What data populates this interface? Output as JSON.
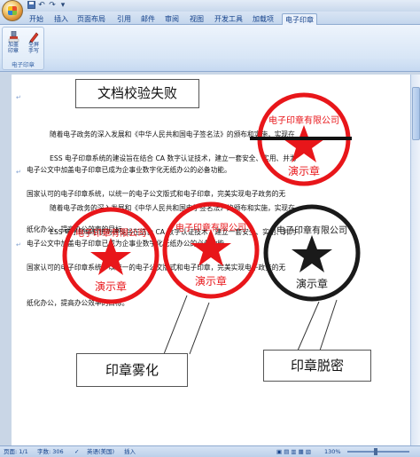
{
  "quick_access": {
    "save_icon": "save-icon",
    "undo_icon": "undo-icon",
    "redo_icon": "redo-icon"
  },
  "tabs": [
    {
      "label": "开始",
      "active": false
    },
    {
      "label": "插入",
      "active": false
    },
    {
      "label": "页面布局",
      "active": false
    },
    {
      "label": "引用",
      "active": false
    },
    {
      "label": "邮件",
      "active": false
    },
    {
      "label": "审阅",
      "active": false
    },
    {
      "label": "视图",
      "active": false
    },
    {
      "label": "开发工具",
      "active": false
    },
    {
      "label": "加载项",
      "active": false
    },
    {
      "label": "电子印章",
      "active": true
    }
  ],
  "ribbon": {
    "group_label": "电子印章",
    "buttons": [
      {
        "label": "加盖\n印章",
        "icon": "seal-icon"
      },
      {
        "label": "全屏\n手写",
        "icon": "pen-icon"
      }
    ]
  },
  "document": {
    "paragraphs": [
      [
        "随着电子政务的深入发展和《中华人民共和国电子签名法》的颁布和实施，实现在",
        "电子公文中加盖电子印章已成为企事业数字化无纸办公的必备功能。"
      ],
      [
        "ESS 电子印章系统的建设旨在结合 CA 数字认证技术，建立一套安全、实用、并为",
        "国家认可的电子印章系统，以统一的电子公文版式和电子印章，完美实现电子政务的无",
        "纸化办公，提高办公效率的目标。"
      ],
      [
        "随着电子政务的深入发展和《中华人民共和国电子签名法》的颁布和实施，实现在",
        "电子公文中加盖电子印章已成为企事业数字化无纸办公的必备功能。"
      ],
      [
        "ESS 电子印章系统的建设旨在结合 CA 数字认证技术，建立一套安全、实用、并为",
        "国家认可的电子印章系统，以统一的电子公文版式和电子印章，完美实现电子政务的无",
        "纸化办公，提高办公效率的目标。"
      ]
    ]
  },
  "callouts": {
    "verify_failed": "文档校验失败",
    "seal_fogged": "印章雾化",
    "seal_obscured": "印章脱密"
  },
  "stamps": {
    "bottom_text": "演示章",
    "top_text": "电子印章有限公司",
    "colors": {
      "red": "#e8161a",
      "black": "#1a1a1a"
    }
  },
  "status_bar": {
    "page": "页面: 1/1",
    "words": "字数: 306",
    "language": "英语(美国)",
    "insert_mode": "插入",
    "zoom": "130%"
  }
}
